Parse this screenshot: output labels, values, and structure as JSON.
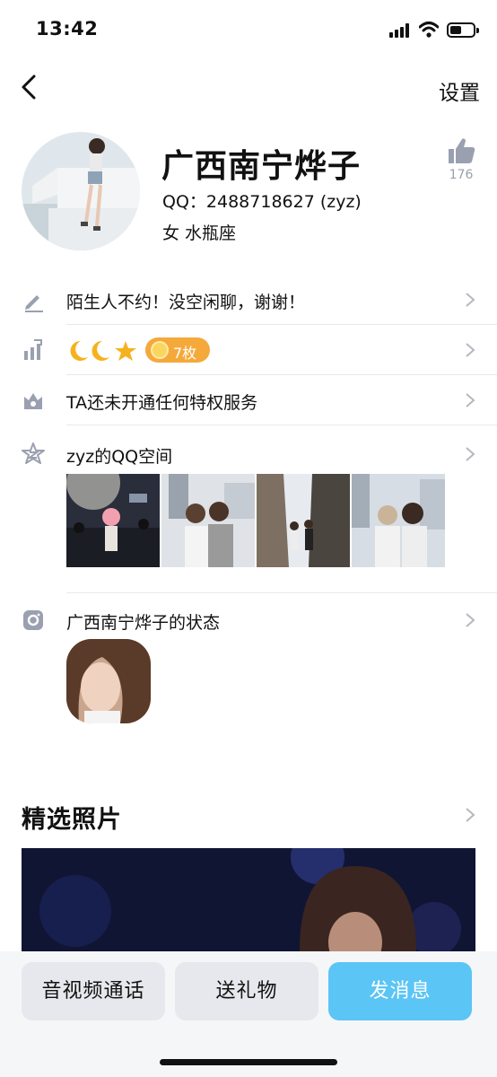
{
  "status_bar": {
    "time": "13:42"
  },
  "nav": {
    "settings_label": "设置"
  },
  "profile": {
    "name": "广西南宁烨子",
    "qq": "QQ：2488718627 (zyz)",
    "gender_sign": "女  水瓶座",
    "likes": "176"
  },
  "rows": {
    "signature": "陌生人不约！没空闲聊，谢谢！",
    "level_badge": "7枚",
    "privilege": "TA还未开通任何特权服务",
    "qzone": "zyz的QQ空间",
    "status": "广西南宁烨子的状态"
  },
  "featured": {
    "title": "精选照片"
  },
  "actions": {
    "call": "音视频通话",
    "gift": "送礼物",
    "message": "发消息"
  },
  "colors": {
    "accent_blue": "#5bc5f5",
    "badge_orange": "#f5a93b",
    "icon_gray": "#9aa0b0"
  }
}
